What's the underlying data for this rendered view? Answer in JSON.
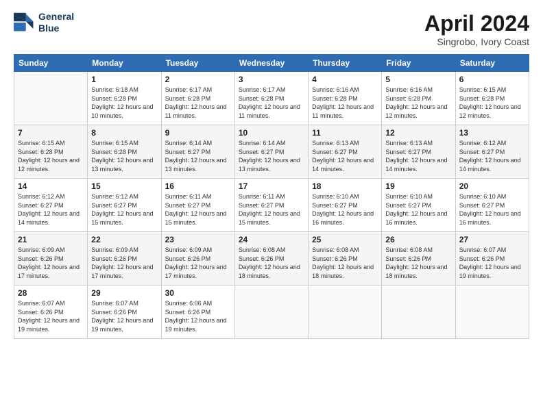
{
  "header": {
    "logo_line1": "General",
    "logo_line2": "Blue",
    "month": "April 2024",
    "location": "Singrobo, Ivory Coast"
  },
  "weekdays": [
    "Sunday",
    "Monday",
    "Tuesday",
    "Wednesday",
    "Thursday",
    "Friday",
    "Saturday"
  ],
  "weeks": [
    [
      {
        "day": "",
        "sunrise": "",
        "sunset": "",
        "daylight": ""
      },
      {
        "day": "1",
        "sunrise": "6:18 AM",
        "sunset": "6:28 PM",
        "daylight": "12 hours and 10 minutes."
      },
      {
        "day": "2",
        "sunrise": "6:17 AM",
        "sunset": "6:28 PM",
        "daylight": "12 hours and 11 minutes."
      },
      {
        "day": "3",
        "sunrise": "6:17 AM",
        "sunset": "6:28 PM",
        "daylight": "12 hours and 11 minutes."
      },
      {
        "day": "4",
        "sunrise": "6:16 AM",
        "sunset": "6:28 PM",
        "daylight": "12 hours and 11 minutes."
      },
      {
        "day": "5",
        "sunrise": "6:16 AM",
        "sunset": "6:28 PM",
        "daylight": "12 hours and 12 minutes."
      },
      {
        "day": "6",
        "sunrise": "6:15 AM",
        "sunset": "6:28 PM",
        "daylight": "12 hours and 12 minutes."
      }
    ],
    [
      {
        "day": "7",
        "sunrise": "6:15 AM",
        "sunset": "6:28 PM",
        "daylight": "12 hours and 12 minutes."
      },
      {
        "day": "8",
        "sunrise": "6:15 AM",
        "sunset": "6:28 PM",
        "daylight": "12 hours and 13 minutes."
      },
      {
        "day": "9",
        "sunrise": "6:14 AM",
        "sunset": "6:27 PM",
        "daylight": "12 hours and 13 minutes."
      },
      {
        "day": "10",
        "sunrise": "6:14 AM",
        "sunset": "6:27 PM",
        "daylight": "12 hours and 13 minutes."
      },
      {
        "day": "11",
        "sunrise": "6:13 AM",
        "sunset": "6:27 PM",
        "daylight": "12 hours and 14 minutes."
      },
      {
        "day": "12",
        "sunrise": "6:13 AM",
        "sunset": "6:27 PM",
        "daylight": "12 hours and 14 minutes."
      },
      {
        "day": "13",
        "sunrise": "6:12 AM",
        "sunset": "6:27 PM",
        "daylight": "12 hours and 14 minutes."
      }
    ],
    [
      {
        "day": "14",
        "sunrise": "6:12 AM",
        "sunset": "6:27 PM",
        "daylight": "12 hours and 14 minutes."
      },
      {
        "day": "15",
        "sunrise": "6:12 AM",
        "sunset": "6:27 PM",
        "daylight": "12 hours and 15 minutes."
      },
      {
        "day": "16",
        "sunrise": "6:11 AM",
        "sunset": "6:27 PM",
        "daylight": "12 hours and 15 minutes."
      },
      {
        "day": "17",
        "sunrise": "6:11 AM",
        "sunset": "6:27 PM",
        "daylight": "12 hours and 15 minutes."
      },
      {
        "day": "18",
        "sunrise": "6:10 AM",
        "sunset": "6:27 PM",
        "daylight": "12 hours and 16 minutes."
      },
      {
        "day": "19",
        "sunrise": "6:10 AM",
        "sunset": "6:27 PM",
        "daylight": "12 hours and 16 minutes."
      },
      {
        "day": "20",
        "sunrise": "6:10 AM",
        "sunset": "6:27 PM",
        "daylight": "12 hours and 16 minutes."
      }
    ],
    [
      {
        "day": "21",
        "sunrise": "6:09 AM",
        "sunset": "6:26 PM",
        "daylight": "12 hours and 17 minutes."
      },
      {
        "day": "22",
        "sunrise": "6:09 AM",
        "sunset": "6:26 PM",
        "daylight": "12 hours and 17 minutes."
      },
      {
        "day": "23",
        "sunrise": "6:09 AM",
        "sunset": "6:26 PM",
        "daylight": "12 hours and 17 minutes."
      },
      {
        "day": "24",
        "sunrise": "6:08 AM",
        "sunset": "6:26 PM",
        "daylight": "12 hours and 18 minutes."
      },
      {
        "day": "25",
        "sunrise": "6:08 AM",
        "sunset": "6:26 PM",
        "daylight": "12 hours and 18 minutes."
      },
      {
        "day": "26",
        "sunrise": "6:08 AM",
        "sunset": "6:26 PM",
        "daylight": "12 hours and 18 minutes."
      },
      {
        "day": "27",
        "sunrise": "6:07 AM",
        "sunset": "6:26 PM",
        "daylight": "12 hours and 19 minutes."
      }
    ],
    [
      {
        "day": "28",
        "sunrise": "6:07 AM",
        "sunset": "6:26 PM",
        "daylight": "12 hours and 19 minutes."
      },
      {
        "day": "29",
        "sunrise": "6:07 AM",
        "sunset": "6:26 PM",
        "daylight": "12 hours and 19 minutes."
      },
      {
        "day": "30",
        "sunrise": "6:06 AM",
        "sunset": "6:26 PM",
        "daylight": "12 hours and 19 minutes."
      },
      {
        "day": "",
        "sunrise": "",
        "sunset": "",
        "daylight": ""
      },
      {
        "day": "",
        "sunrise": "",
        "sunset": "",
        "daylight": ""
      },
      {
        "day": "",
        "sunrise": "",
        "sunset": "",
        "daylight": ""
      },
      {
        "day": "",
        "sunrise": "",
        "sunset": "",
        "daylight": ""
      }
    ]
  ]
}
